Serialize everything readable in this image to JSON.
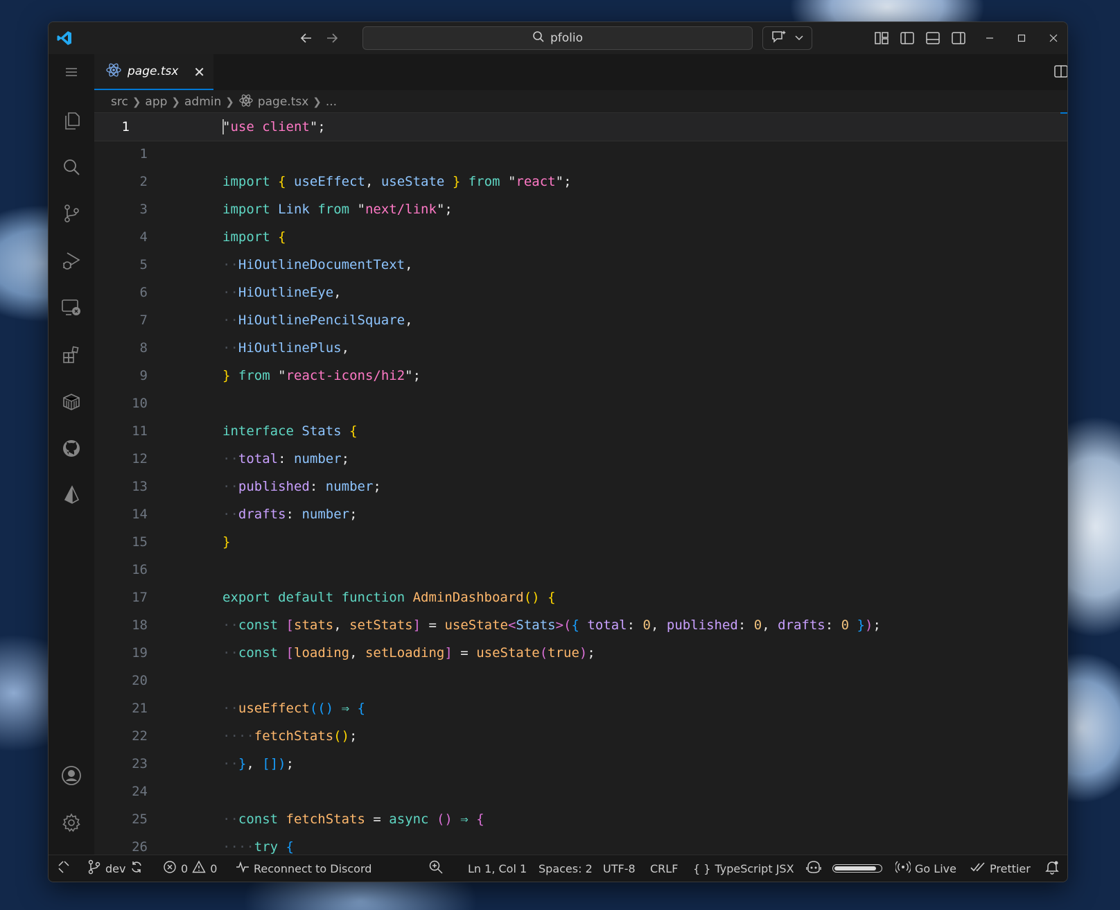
{
  "titlebar": {
    "search_text": "pfolio"
  },
  "tab": {
    "label": "page.tsx"
  },
  "breadcrumb": {
    "items": [
      "src",
      "app",
      "admin",
      "page.tsx",
      "..."
    ]
  },
  "editor": {
    "current_line_number": "1",
    "line_numbers": [
      "1",
      "2",
      "3",
      "4",
      "5",
      "6",
      "7",
      "8",
      "9",
      "10",
      "11",
      "12",
      "13",
      "14",
      "15",
      "16",
      "17",
      "18",
      "19",
      "20",
      "21",
      "22",
      "23",
      "24",
      "25",
      "26"
    ]
  },
  "statusbar": {
    "branch": "dev",
    "errors": "0",
    "warnings": "0",
    "discord": "Reconnect to Discord",
    "position": "Ln 1, Col 1",
    "spaces": "Spaces: 2",
    "encoding": "UTF-8",
    "eol": "CRLF",
    "language": "TypeScript JSX",
    "go_live": "Go Live",
    "prettier": "Prettier"
  },
  "colors": {
    "accent": "#0078d4",
    "keyword": "#5fd7c4",
    "string": "#ff79c6",
    "identifier": "#8ec5ff",
    "function": "#ffb86c",
    "property": "#c9a0ff",
    "bracket_gold": "#ffd700",
    "bracket_purple": "#da70d6",
    "bracket_blue": "#179fff"
  },
  "icons": {
    "titlebar": [
      "vscode-logo-icon",
      "arrow-left-icon",
      "arrow-right-icon",
      "search-icon",
      "chat-icon",
      "chevron-down-icon",
      "customize-layout-icon",
      "toggle-primary-sidebar-icon",
      "toggle-panel-icon",
      "toggle-secondary-sidebar-icon",
      "minimize-icon",
      "maximize-icon",
      "close-icon"
    ],
    "activity": [
      "menu-icon",
      "explorer-icon",
      "search-icon",
      "source-control-icon",
      "run-debug-icon",
      "remote-explorer-icon",
      "extensions-icon",
      "containers-icon",
      "github-icon",
      "prisma-icon",
      "account-icon",
      "settings-gear-icon"
    ]
  }
}
